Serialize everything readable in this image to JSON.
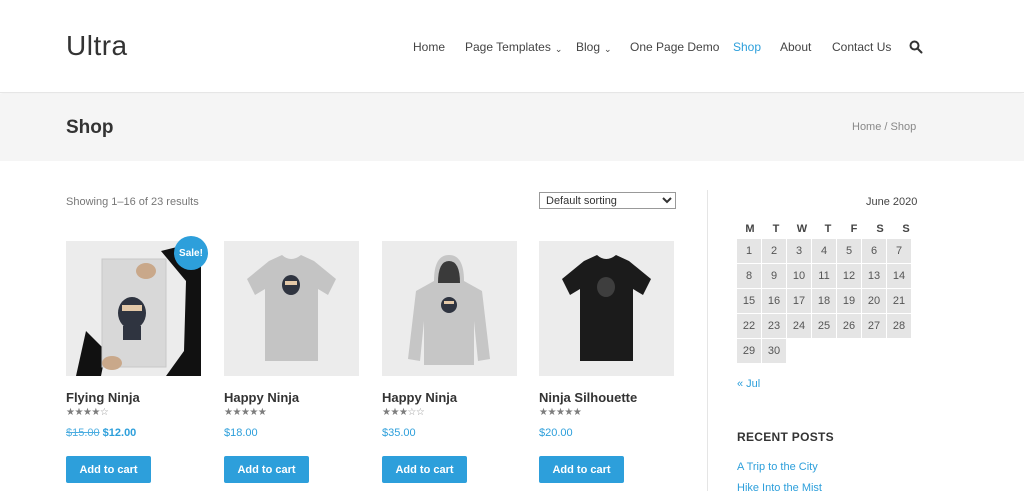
{
  "site": {
    "logo": "Ultra"
  },
  "nav": {
    "items": [
      {
        "label": "Home"
      },
      {
        "label": "Page Templates",
        "chevron": "⌄"
      },
      {
        "label": "Blog",
        "chevron": "⌄"
      },
      {
        "label": "One Page Demo"
      },
      {
        "label": "Shop",
        "active": true
      },
      {
        "label": "About"
      },
      {
        "label": "Contact Us"
      }
    ],
    "search_icon": "search-icon"
  },
  "titlebar": {
    "title": "Shop",
    "breadcrumb": {
      "home": "Home",
      "separator": " / ",
      "current": "Shop"
    }
  },
  "shop": {
    "results_text": "Showing 1–16 of 23 results",
    "sort_selected": "Default sorting",
    "add_to_cart_label": "Add to cart",
    "sale_label": "Sale!",
    "products": [
      {
        "name": "Flying Ninja",
        "rating": 4,
        "old_price": "$15.00",
        "price": "$12.00",
        "on_sale": true
      },
      {
        "name": "Happy Ninja",
        "rating": 5,
        "price": "$18.00"
      },
      {
        "name": "Happy Ninja",
        "rating": 3,
        "price": "$35.00"
      },
      {
        "name": "Ninja Silhouette",
        "rating": 5,
        "price": "$20.00"
      }
    ]
  },
  "calendar": {
    "caption": "June 2020",
    "weekdays": [
      "M",
      "T",
      "W",
      "T",
      "F",
      "S",
      "S"
    ],
    "weeks": [
      [
        "1",
        "2",
        "3",
        "4",
        "5",
        "6",
        "7"
      ],
      [
        "8",
        "9",
        "10",
        "11",
        "12",
        "13",
        "14"
      ],
      [
        "15",
        "16",
        "17",
        "18",
        "19",
        "20",
        "21"
      ],
      [
        "22",
        "23",
        "24",
        "25",
        "26",
        "27",
        "28"
      ],
      [
        "29",
        "30",
        "",
        "",
        "",
        "",
        ""
      ]
    ],
    "prev_link": "« Jul"
  },
  "recent_posts": {
    "title": "RECENT POSTS",
    "items": [
      "A Trip to the City",
      "Hike Into the Mist"
    ]
  },
  "colors": {
    "accent": "#2d9fdb",
    "titlebar_bg": "#f5f5f5",
    "cell_bg": "#e5e5e5"
  }
}
